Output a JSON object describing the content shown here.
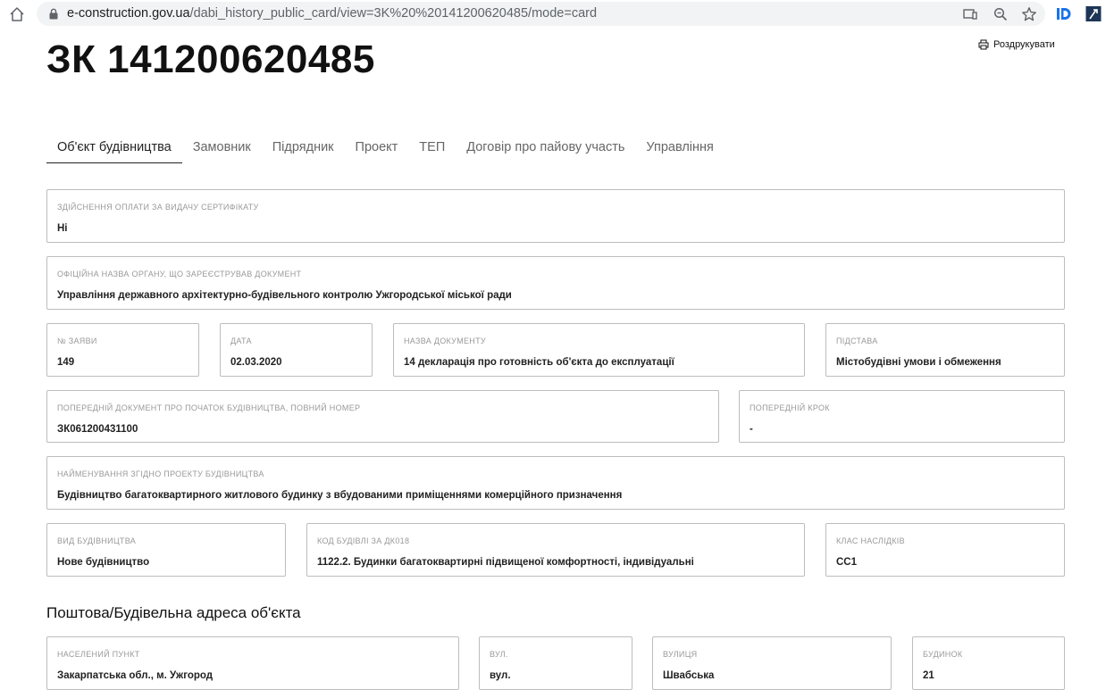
{
  "browser": {
    "url_host": "e-construction.gov.ua",
    "url_path": "/dabi_history_public_card/view=3K%20%20141200620485/mode=card"
  },
  "page": {
    "title": "ЗК 141200620485",
    "print_label": "Роздрукувати"
  },
  "tabs": [
    {
      "label": "Об'єкт будівництва",
      "active": true
    },
    {
      "label": "Замовник"
    },
    {
      "label": "Підрядник"
    },
    {
      "label": "Проект"
    },
    {
      "label": "ТЕП"
    },
    {
      "label": "Договір про пайову участь"
    },
    {
      "label": "Управління"
    }
  ],
  "fields": {
    "payment": {
      "label": "Здійснення оплати за видачу сертифікату",
      "value": "Ні"
    },
    "authority": {
      "label": "Офіційна назва органу, що зареєстрував документ",
      "value": "Управління державного архітектурно-будівельного контролю Ужгородської міської ради"
    },
    "application_no": {
      "label": "№ заяви",
      "value": "149"
    },
    "date": {
      "label": "Дата",
      "value": "02.03.2020"
    },
    "doc_name": {
      "label": "Назва документу",
      "value": "14 декларація про готовність об'єкта до експлуатації"
    },
    "basis": {
      "label": "Підстава",
      "value": "Містобудівні умови і обмеження"
    },
    "prev_doc": {
      "label": "Попередній документ про початок будівництва, повний номер",
      "value": "ЗК061200431100"
    },
    "prev_step": {
      "label": "Попередній крок",
      "value": "-"
    },
    "project_name": {
      "label": "Найменування згідно проекту будівництва",
      "value": "Будівництво багатоквартирного житлового будинку з вбудованими приміщеннями комерційного призначення"
    },
    "construction_type": {
      "label": "Вид будівництва",
      "value": "Нове будівництво"
    },
    "building_code": {
      "label": "Код будівлі за ДК018",
      "value": "1122.2. Будинки багатоквартирні підвищеної комфортності, індивідуальні"
    },
    "consequence_class": {
      "label": "Клас наслідків",
      "value": "СС1"
    }
  },
  "address": {
    "section_title": "Поштова/Будівельна адреса об'єкта",
    "locality": {
      "label": "Населений пункт",
      "value": "Закарпатська обл., м. Ужгород"
    },
    "street_type": {
      "label": "Вул.",
      "value": "вул."
    },
    "street": {
      "label": "Вулиця",
      "value": "Швабська"
    },
    "building": {
      "label": "Будинок",
      "value": "21"
    }
  }
}
